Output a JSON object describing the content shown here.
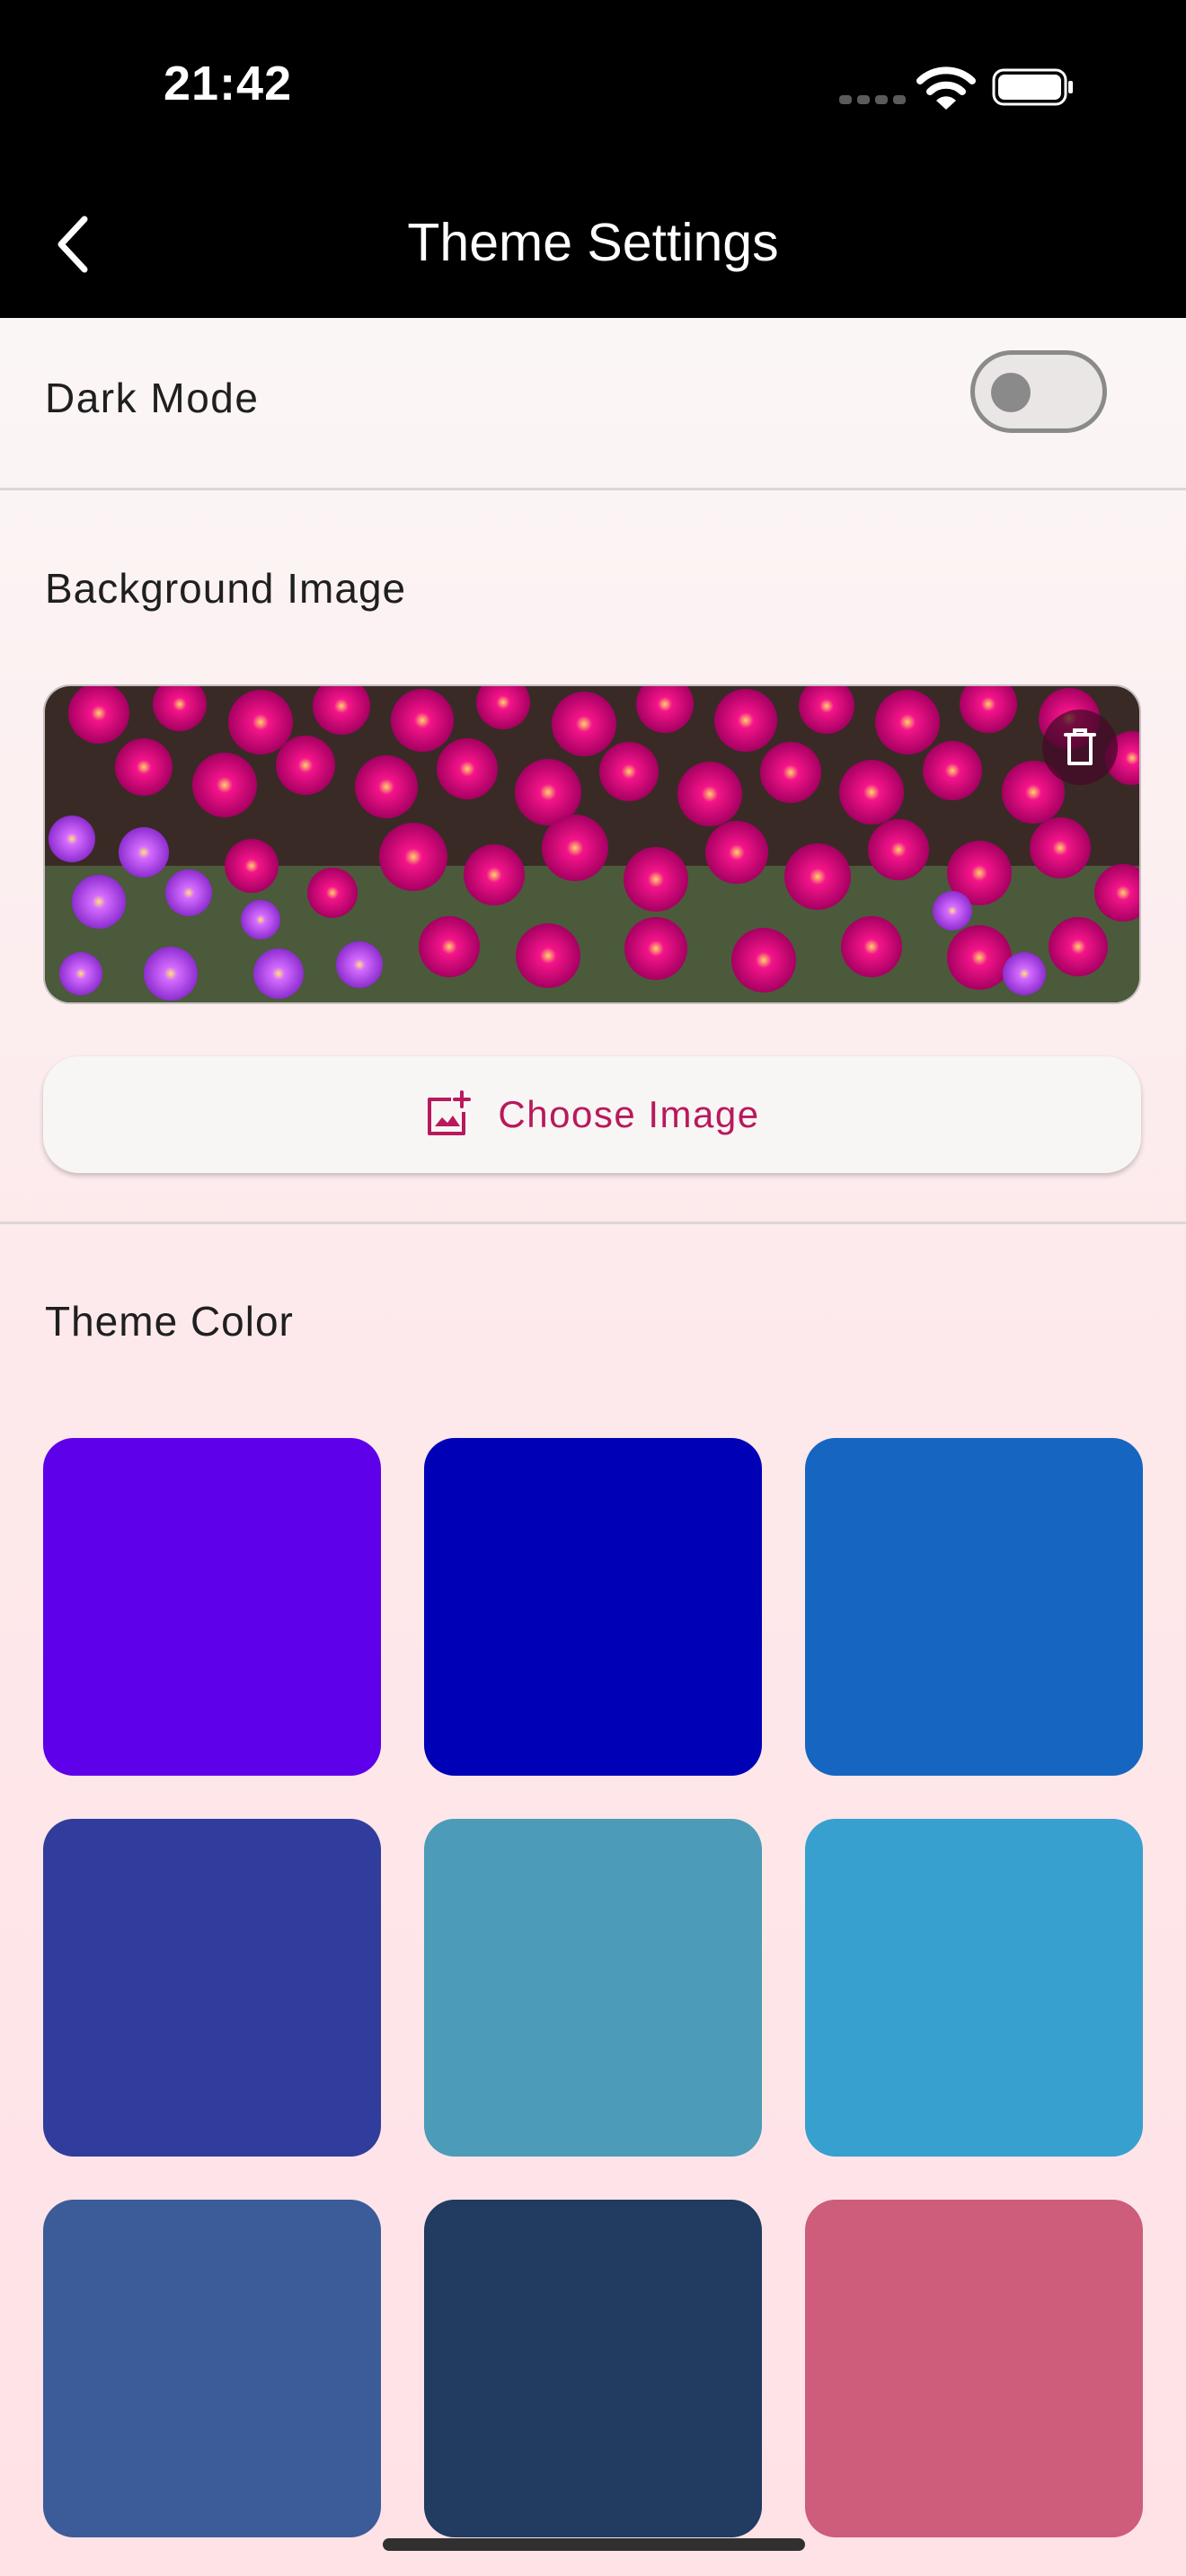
{
  "status_bar": {
    "time": "21:42"
  },
  "nav": {
    "title": "Theme Settings"
  },
  "dark_mode": {
    "label": "Dark Mode",
    "enabled": false
  },
  "background_image": {
    "title": "Background Image",
    "choose_label": "Choose Image",
    "choose_icon": "add-photo-icon",
    "delete_icon": "trash-icon"
  },
  "theme_color": {
    "title": "Theme Color",
    "swatches": [
      "#5E00E9",
      "#0000B7",
      "#1665C1",
      "#303D9C",
      "#4B9BB9",
      "#37A0CE",
      "#3B5C99",
      "#223B60",
      "#CE5C7B"
    ]
  },
  "colors": {
    "accent": "#B8195C",
    "bar_bg": "#000000"
  }
}
